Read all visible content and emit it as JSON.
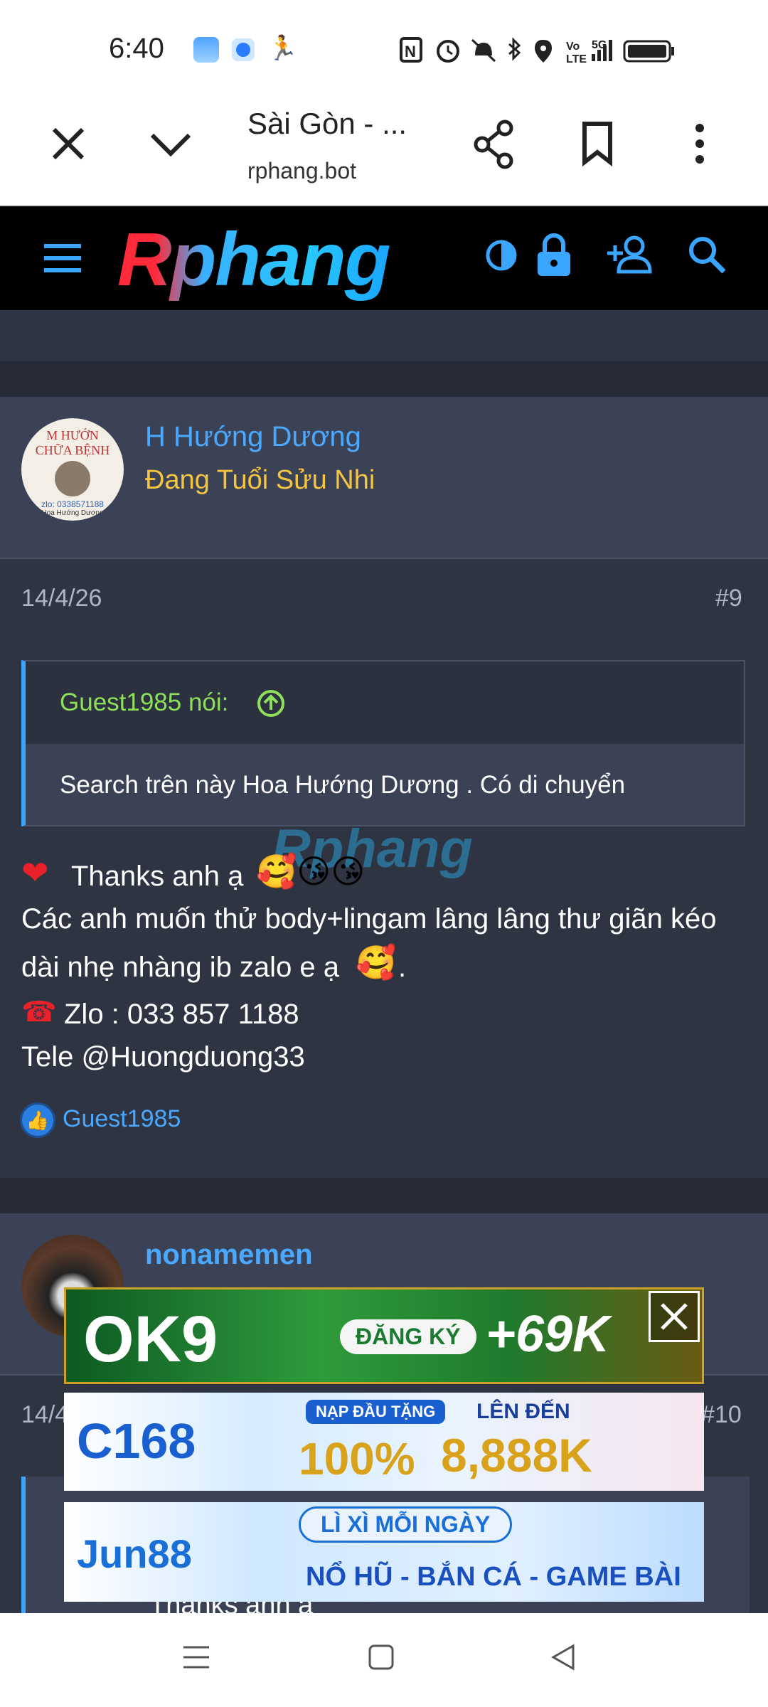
{
  "status_bar": {
    "time": "6:40"
  },
  "tab": {
    "title": "Sài Gòn - ...",
    "url": "rphang.bot"
  },
  "site": {
    "logo_text": "Rphang",
    "watermark_text": "Rphang"
  },
  "post9": {
    "author": "H Hướng Dương",
    "user_title": "Đang Tuổi Sửu Nhi",
    "avatar_text": [
      "M HƯỚN",
      "CHỮA BỆNH",
      "zlo: 0338571188",
      "Hoa Hướng Dương"
    ],
    "date": "14/4/26",
    "number": "#9",
    "quote_author": "Guest1985 nói:",
    "quote_text": "Search trên này Hoa Hướng Dương . Có di chuyển",
    "body_line1": "Thanks anh ạ",
    "body_line2": "Các anh muốn thử body+lingam lâng lâng thư giãn kéo",
    "body_line3": "dài nhẹ nhàng ib zalo e ạ",
    "body_line3_end": ".",
    "body_line4": "Zlo : 033 857 1188",
    "body_line5": "Tele @Huongduong33",
    "reaction_user": "Guest1985"
  },
  "post10": {
    "author": "nonamemen",
    "date": "14/4",
    "number": "#10",
    "body_peek": "Thanks anh ạ"
  },
  "ads": [
    {
      "brand": "OK9",
      "cta": "ĐĂNG KÝ",
      "bonus": "+69K"
    },
    {
      "brand": "C168",
      "tag": "NẠP ĐẦU TẶNG",
      "percent": "100%",
      "tag2": "LÊN ĐẾN",
      "amount": "8,888K"
    },
    {
      "brand": "Jun88",
      "tag": "LÌ XÌ MỖI NGÀY",
      "line": "NỔ HŨ - BẮN CÁ - GAME BÀI"
    }
  ],
  "colors": {
    "accent": "#4aa8ff",
    "quote_author": "#8ee05a",
    "user_title": "#f5c542",
    "background": "#2f3443"
  }
}
